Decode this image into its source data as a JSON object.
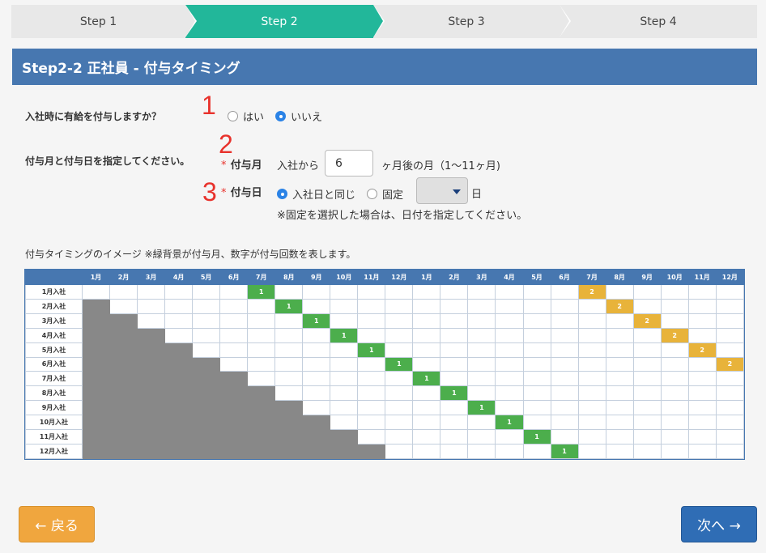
{
  "stepper": {
    "steps": [
      {
        "label": "Step 1",
        "active": false
      },
      {
        "label": "Step 2",
        "active": true
      },
      {
        "label": "Step 3",
        "active": false
      },
      {
        "label": "Step 4",
        "active": false
      }
    ]
  },
  "header": {
    "title": "Step2-2 正社員 - 付与タイミング"
  },
  "annotations": [
    "1",
    "2",
    "3"
  ],
  "question1": {
    "label": "入社時に有給を付与しますか？",
    "options": [
      {
        "label": "はい",
        "checked": false
      },
      {
        "label": "いいえ",
        "checked": true
      }
    ]
  },
  "question2": {
    "label": "付与月と付与日を指定してください。",
    "month": {
      "required_mark": "*",
      "label": "付与月",
      "prefix": "入社から",
      "value": "6",
      "suffix": "ヶ月後の月（1〜11ヶ月)"
    },
    "day": {
      "required_mark": "*",
      "label": "付与日",
      "options": [
        {
          "label": "入社日と同じ",
          "checked": true
        },
        {
          "label": "固定",
          "checked": false
        }
      ],
      "select_value": "",
      "suffix": "日",
      "note": "※固定を選択した場合は、日付を指定してください。"
    }
  },
  "image_caption": "付与タイミングのイメージ ※緑背景が付与月、数字が付与回数を表します。",
  "grid": {
    "months": [
      "1月",
      "2月",
      "3月",
      "4月",
      "5月",
      "6月",
      "7月",
      "8月",
      "9月",
      "10月",
      "11月",
      "12月",
      "1月",
      "2月",
      "3月",
      "4月",
      "5月",
      "6月",
      "7月",
      "8月",
      "9月",
      "10月",
      "11月",
      "12月"
    ],
    "rows": [
      "1月入社",
      "2月入社",
      "3月入社",
      "4月入社",
      "5月入社",
      "6月入社",
      "7月入社",
      "8月入社",
      "9月入社",
      "10月入社",
      "11月入社",
      "12月入社"
    ],
    "grant_offset_months": 6,
    "first_grant_label": "1",
    "second_grant_label": "2",
    "colors": {
      "first_grant": "#4cae4c",
      "second_grant": "#e8b33a",
      "before_join": "#888888",
      "header": "#4777b0"
    }
  },
  "buttons": {
    "back_label": "← 戻る",
    "next_label": "次へ →"
  },
  "colors": {
    "accent": "#22b79a",
    "header_bg": "#4777b0",
    "back_btn": "#f0a63e",
    "next_btn": "#2f6db5",
    "annotation": "#e8322c"
  }
}
